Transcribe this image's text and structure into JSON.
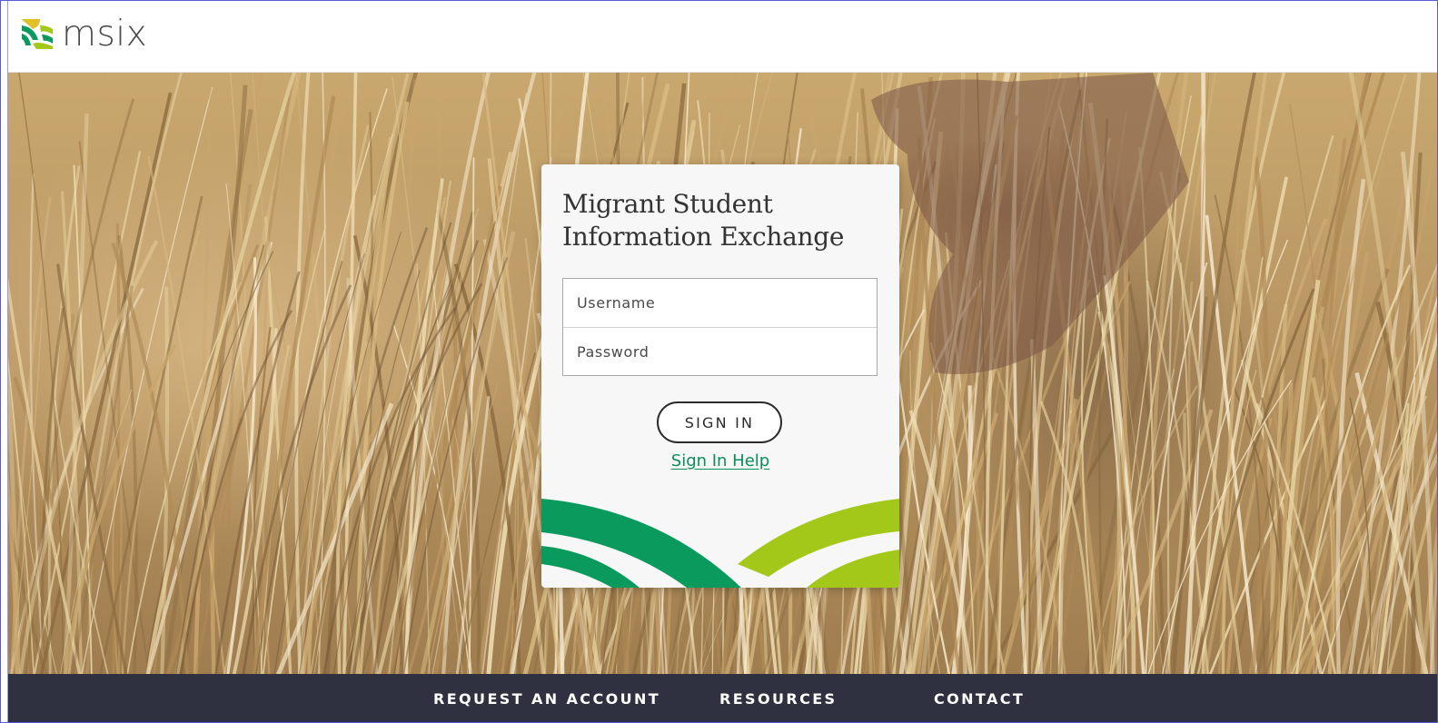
{
  "header": {
    "logo_text": "msix"
  },
  "login_card": {
    "title_line1": "Migrant Student",
    "title_line2": "Information Exchange",
    "username_placeholder": "Username",
    "password_placeholder": "Password",
    "sign_in_label": "SIGN IN",
    "help_link_label": "Sign In Help"
  },
  "footer": {
    "links": [
      {
        "label": "REQUEST AN ACCOUNT"
      },
      {
        "label": "RESOURCES"
      },
      {
        "label": "CONTACT"
      }
    ]
  },
  "colors": {
    "brand_green": "#0b9a5d",
    "brand_lime": "#a4c81a",
    "brand_yellow": "#e2c02a",
    "footer_bg": "#2f3140",
    "link_green": "#0a8e5b"
  },
  "icons": {
    "logo_mark": "msix-logo-icon"
  }
}
